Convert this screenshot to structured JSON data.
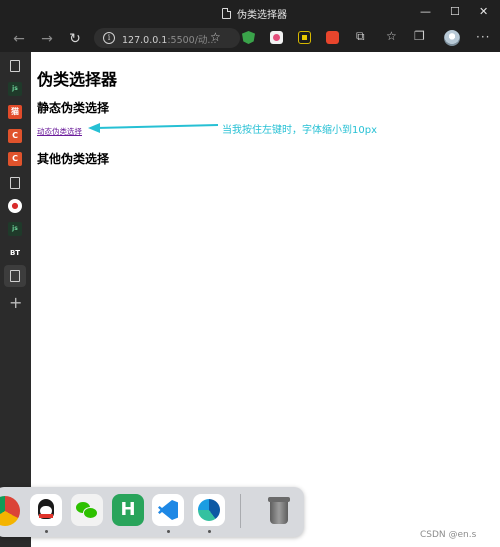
{
  "window": {
    "title": "伪类选择器",
    "controls": [
      "—",
      "☐",
      "✕"
    ]
  },
  "toolbar": {
    "back_icon": "back-arrow-icon",
    "forward_icon": "forward-arrow-icon",
    "reload_icon": "reload-icon",
    "url": {
      "host": "127.0.0.1",
      "rest": ":5500/动..."
    }
  },
  "page": {
    "title": "伪类选择器",
    "section1": "静态伪类选择",
    "link_text": "动态伪类选择",
    "section2": "其他伪类选择"
  },
  "annotation": {
    "text": "当我按住左键时，字体缩小到10px",
    "color": "#26c0d4"
  },
  "sidebar": {
    "items": [
      "BT"
    ]
  },
  "watermark": "CSDN @en.s",
  "colors": {
    "accent_link": "#6a1b9a",
    "chrome_bg": "#202020",
    "sidebar_bg": "#2b2b2b"
  }
}
